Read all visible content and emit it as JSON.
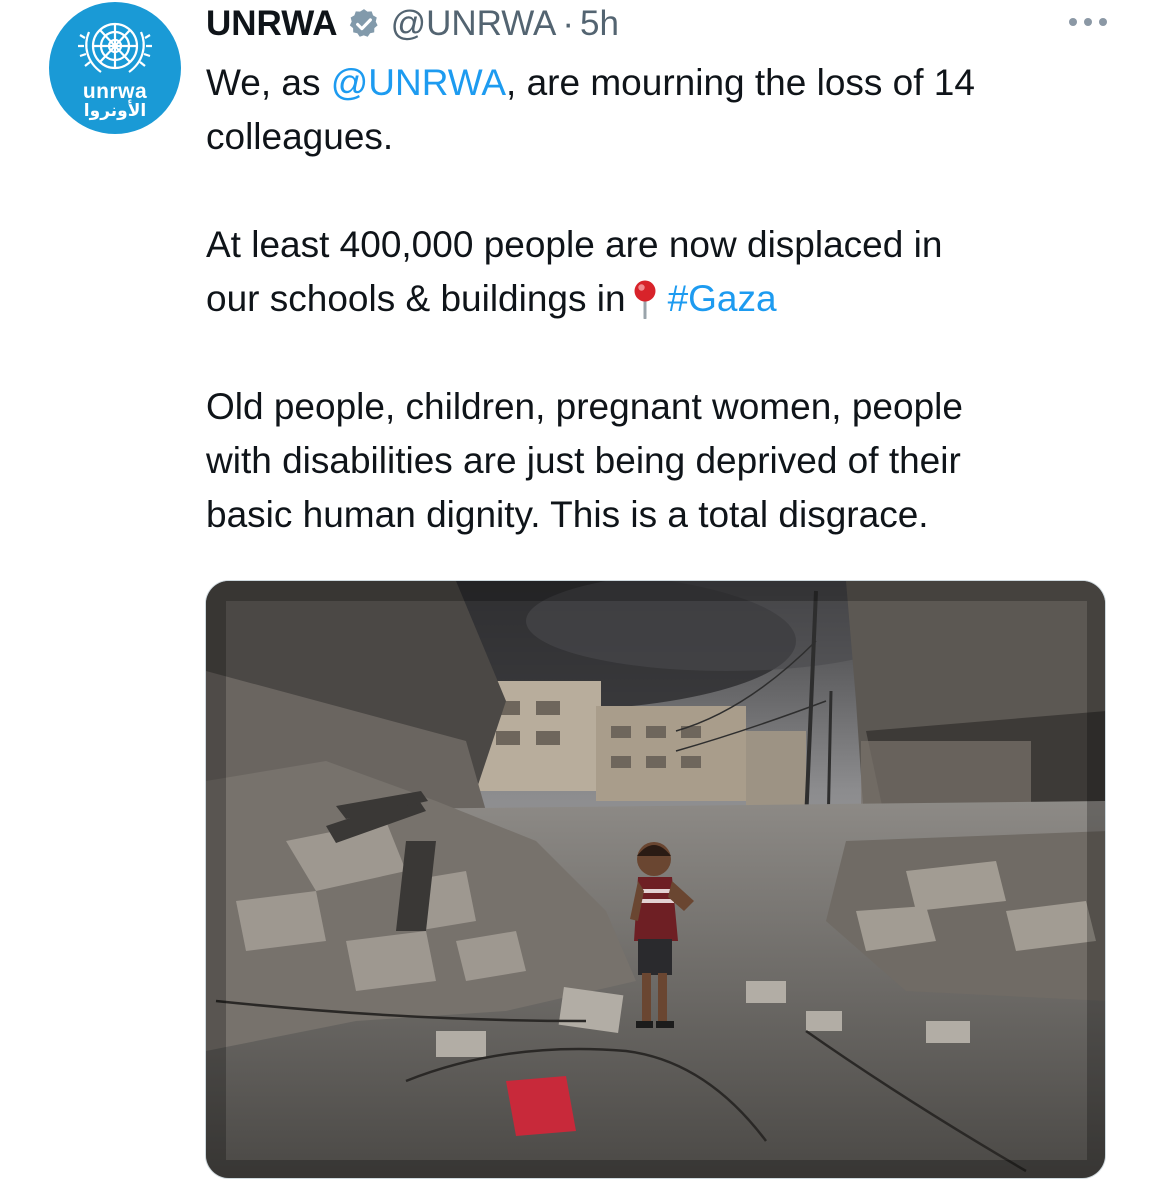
{
  "tweet": {
    "author": {
      "display_name": "UNRWA",
      "handle": "@UNRWA",
      "verified": true,
      "avatar_logo_en": "unrwa",
      "avatar_logo_ar": "الأونروا"
    },
    "separator": "·",
    "time": "5h",
    "more_icon": "more-horizontal-icon",
    "text": {
      "line1_prefix": "We, as ",
      "mention": "@UNRWA",
      "line1_suffix": ", are mourning the loss of 14",
      "line2": "colleagues.",
      "line3": "At least 400,000 people are now displaced in",
      "line4_prefix": "our schools & buildings in",
      "pin_icon": "round-pushpin-icon",
      "hashtag": "#Gaza",
      "line5": "Old people, children, pregnant women, people",
      "line6": "with disabilities are just being deprived of their",
      "line7": "basic human dignity. This is a total disgrace."
    },
    "media": {
      "type": "photo",
      "subject": "child-standing-in-rubble"
    }
  },
  "colors": {
    "link": "#1d9bf0",
    "text": "#0f1419",
    "secondary": "#536471",
    "avatar_bg": "#1a9ad6"
  }
}
